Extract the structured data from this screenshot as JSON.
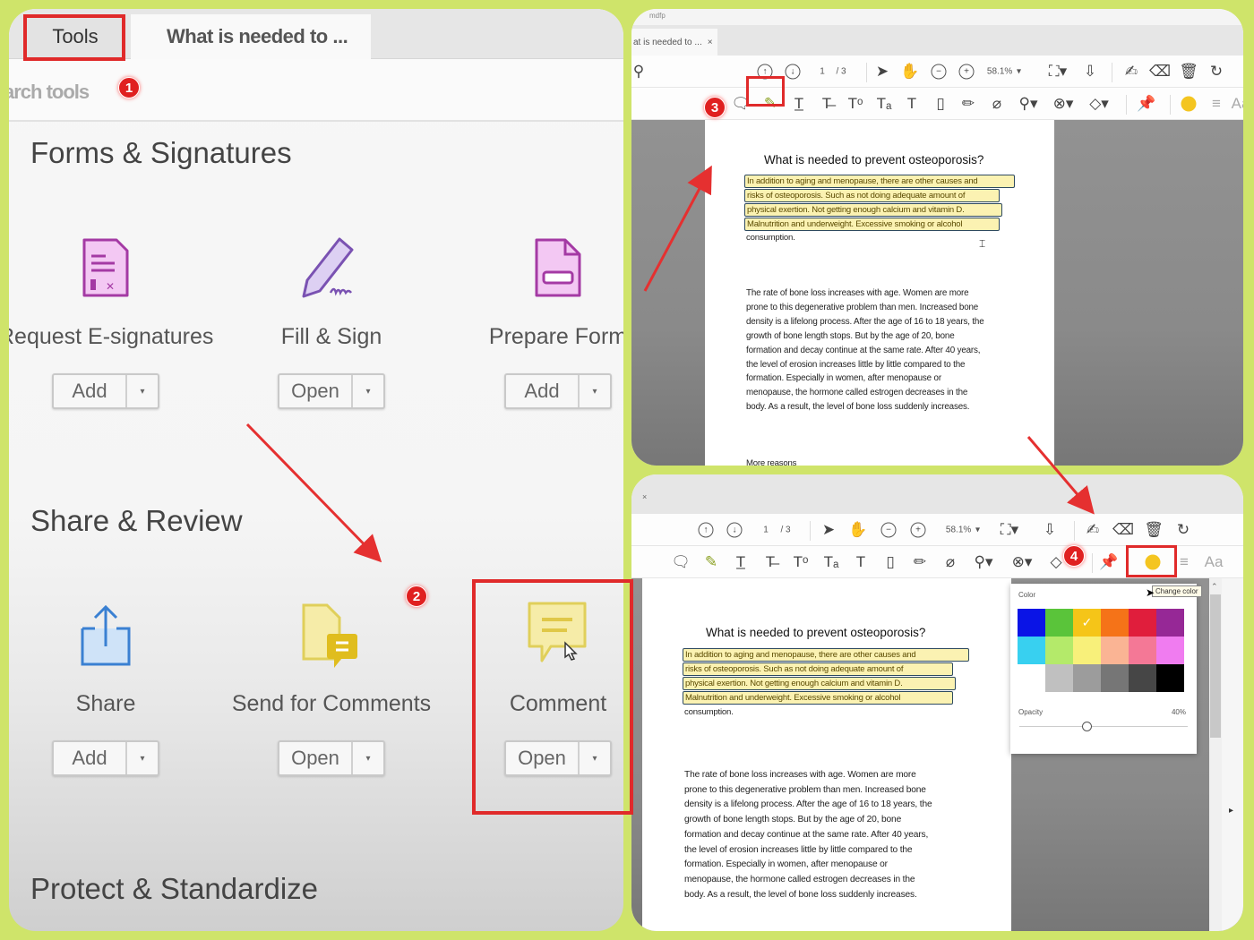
{
  "left_panel": {
    "tabs": [
      {
        "label": "Tools"
      },
      {
        "label": "What is needed to ..."
      }
    ],
    "search_placeholder": "Search tools",
    "search_visible": "arch tools",
    "sections": [
      {
        "title": "Forms & Signatures",
        "tools": [
          {
            "name": "Request E-signatures",
            "button": "Add",
            "icon": "request-signature-icon"
          },
          {
            "name": "Fill & Sign",
            "button": "Open",
            "icon": "fill-sign-icon"
          },
          {
            "name": "Prepare Form",
            "button": "Add",
            "icon": "prepare-form-icon"
          }
        ]
      },
      {
        "title": "Share & Review",
        "tools": [
          {
            "name": "Share",
            "button": "Add",
            "icon": "share-icon"
          },
          {
            "name": "Send for Comments",
            "button": "Open",
            "icon": "send-comments-icon"
          },
          {
            "name": "Comment",
            "button": "Open",
            "icon": "comment-icon"
          }
        ]
      },
      {
        "title": "Protect & Standardize"
      }
    ],
    "dropdown_glyph": "▾"
  },
  "annotations": {
    "badges": [
      "1",
      "2",
      "3",
      "4"
    ],
    "colors": {
      "annotation_red": "#e02a2a"
    }
  },
  "viewer": {
    "title_strip": "mdfp",
    "tab_label": "at is needed to ...",
    "tab_label_bottom": "",
    "close_glyph": "×",
    "page_current": "1",
    "page_total": "/ 3",
    "zoom": "58.1%",
    "document": {
      "title": "What is needed to prevent osteoporosis?",
      "highlighted_lines": [
        "In addition to aging and menopause, there are other causes and",
        "risks of osteoporosis. Such as not doing adequate amount of",
        "physical exertion. Not getting enough calcium and vitamin D.",
        "Malnutrition and underweight. Excessive smoking or alcohol"
      ],
      "after_highlight": "consumption.",
      "paragraph": [
        "The rate of bone loss increases with age. Women are more",
        "prone to this degenerative problem than men. Increased bone",
        "density is a lifelong process. After the age of 16 to 18 years, the",
        "growth of bone length stops. But by the age of 20, bone",
        "formation and decay continue at the same rate. After 40 years,",
        "the level of erosion increases little by little compared to the",
        "formation. Especially in women, after menopause or",
        "menopause, the hormone called estrogen decreases in the",
        "body. As a result, the level of bone loss suddenly increases."
      ],
      "more_text": "More reasons"
    },
    "highlight_color": "#f4c520",
    "font_button": "Aa"
  },
  "color_popup": {
    "color_label": "Color",
    "opacity_label": "Opacity",
    "opacity_value": "40%",
    "opacity_fraction": 0.4,
    "tooltip": "Change color",
    "selected_index": 2,
    "check_glyph": "✓",
    "swatches": [
      "#0a14e6",
      "#5ac43a",
      "#f5c518",
      "#f57318",
      "#e01e3c",
      "#962896",
      "#38d0f0",
      "#b4ea6a",
      "#f8f07a",
      "#fab494",
      "#f47896",
      "#f07cf0",
      "#ffffff",
      "#c0c0c0",
      "#9c9c9c",
      "#767676",
      "#464646",
      "#000000"
    ]
  }
}
